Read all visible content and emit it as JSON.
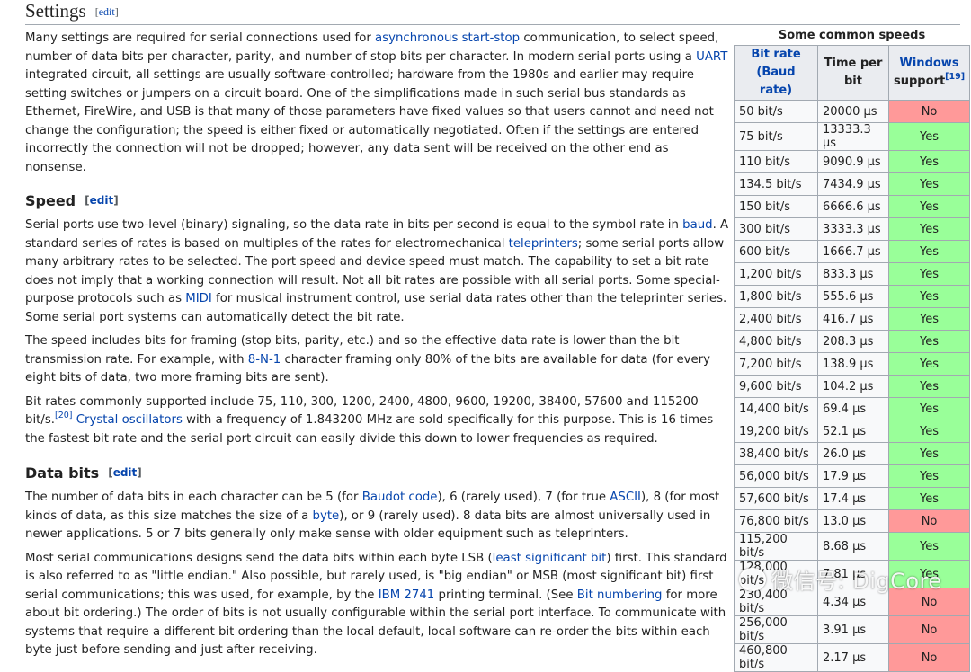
{
  "settings": {
    "heading": "Settings",
    "edit_label": "edit",
    "p1": {
      "t1": "Many settings are required for serial connections used for ",
      "l1": "asynchronous start-stop",
      "t2": " communication, to select speed, number of data bits per character, parity, and number of stop bits per character. In modern serial ports using a ",
      "l2": "UART",
      "t3": " integrated circuit, all settings are usually software-controlled; hardware from the 1980s and earlier may require setting switches or jumpers on a circuit board. One of the simplifications made in such serial bus standards as Ethernet, FireWire, and USB is that many of those parameters have fixed values so that users cannot and need not change the configuration; the speed is either fixed or automatically negotiated. Often if the settings are entered incorrectly the connection will not be dropped; however, any data sent will be received on the other end as nonsense."
    }
  },
  "speed": {
    "heading": "Speed",
    "edit_label": "edit",
    "p1": {
      "t1": "Serial ports use two-level (binary) signaling, so the data rate in bits per second is equal to the symbol rate in ",
      "l1": "baud",
      "t2": ". A standard series of rates is based on multiples of the rates for electromechanical ",
      "l2": "teleprinters",
      "t3": "; some serial ports allow many arbitrary rates to be selected. The port speed and device speed must match. The capability to set a bit rate does not imply that a working connection will result. Not all bit rates are possible with all serial ports. Some special-purpose protocols such as ",
      "l3": "MIDI",
      "t4": " for musical instrument control, use serial data rates other than the teleprinter series. Some serial port systems can automatically detect the bit rate."
    },
    "p2": {
      "t1": "The speed includes bits for framing (stop bits, parity, etc.) and so the effective data rate is lower than the bit transmission rate. For example, with ",
      "l1": "8-N-1",
      "t2": " character framing only 80% of the bits are available for data (for every eight bits of data, two more framing bits are sent)."
    },
    "p3": {
      "t1": "Bit rates commonly supported include 75, 110, 300, 1200, 2400, 4800, 9600, 19200, 38400, 57600 and 115200 bit/s.",
      "ref": "[20]",
      "t2": " ",
      "l1": "Crystal oscillators",
      "t3": " with a frequency of 1.843200 MHz are sold specifically for this purpose. This is 16 times the fastest bit rate and the serial port circuit can easily divide this down to lower frequencies as required."
    }
  },
  "databits": {
    "heading": "Data bits",
    "edit_label": "edit",
    "p1": {
      "t1": "The number of data bits in each character can be 5 (for ",
      "l1": "Baudot code",
      "t2": "), 6 (rarely used), 7 (for true ",
      "l2": "ASCII",
      "t3": "), 8 (for most kinds of data, as this size matches the size of a ",
      "l3": "byte",
      "t4": "), or 9 (rarely used). 8 data bits are almost universally used in newer applications. 5 or 7 bits generally only make sense with older equipment such as teleprinters."
    },
    "p2": {
      "t1": "Most serial communications designs send the data bits within each byte LSB (",
      "l1": "least significant bit",
      "t2": ") first. This standard is also referred to as \"little endian.\" Also possible, but rarely used, is \"big endian\" or MSB (most significant bit) first serial communications; this was used, for example, by the ",
      "l2": "IBM 2741",
      "t3": " printing terminal. (See ",
      "l3": "Bit numbering",
      "t4": " for more about bit ordering.) The order of bits is not usually configurable within the serial port interface. To communicate with systems that require a different bit ordering than the local default, local software can re-order the bits within each byte just before sending and just after receiving."
    }
  },
  "speeds_table": {
    "caption": "Some common speeds",
    "col_rate_l1": "Bit rate",
    "col_rate_l2": "(Baud rate)",
    "col_time_l1": "Time per",
    "col_time_l2": "bit",
    "col_win_l1": "Windows",
    "col_win_l2": "support",
    "col_win_ref": "[19]",
    "rows": [
      {
        "rate": "50 bit/s",
        "time": "20000 µs",
        "support": "No"
      },
      {
        "rate": "75 bit/s",
        "time": "13333.3 µs",
        "support": "Yes"
      },
      {
        "rate": "110 bit/s",
        "time": "9090.9 µs",
        "support": "Yes"
      },
      {
        "rate": "134.5 bit/s",
        "time": "7434.9 µs",
        "support": "Yes"
      },
      {
        "rate": "150 bit/s",
        "time": "6666.6 µs",
        "support": "Yes"
      },
      {
        "rate": "300 bit/s",
        "time": "3333.3 µs",
        "support": "Yes"
      },
      {
        "rate": "600 bit/s",
        "time": "1666.7 µs",
        "support": "Yes"
      },
      {
        "rate": "1,200 bit/s",
        "time": "833.3 µs",
        "support": "Yes"
      },
      {
        "rate": "1,800 bit/s",
        "time": "555.6 µs",
        "support": "Yes"
      },
      {
        "rate": "2,400 bit/s",
        "time": "416.7 µs",
        "support": "Yes"
      },
      {
        "rate": "4,800 bit/s",
        "time": "208.3 µs",
        "support": "Yes"
      },
      {
        "rate": "7,200 bit/s",
        "time": "138.9 µs",
        "support": "Yes"
      },
      {
        "rate": "9,600 bit/s",
        "time": "104.2 µs",
        "support": "Yes"
      },
      {
        "rate": "14,400 bit/s",
        "time": "69.4 µs",
        "support": "Yes"
      },
      {
        "rate": "19,200 bit/s",
        "time": "52.1 µs",
        "support": "Yes"
      },
      {
        "rate": "38,400 bit/s",
        "time": "26.0 µs",
        "support": "Yes"
      },
      {
        "rate": "56,000 bit/s",
        "time": "17.9 µs",
        "support": "Yes"
      },
      {
        "rate": "57,600 bit/s",
        "time": "17.4 µs",
        "support": "Yes"
      },
      {
        "rate": "76,800 bit/s",
        "time": "13.0 µs",
        "support": "No"
      },
      {
        "rate": "115,200 bit/s",
        "time": "8.68 µs",
        "support": "Yes"
      },
      {
        "rate": "128,000 bit/s",
        "time": "7.81 µs",
        "support": "Yes"
      },
      {
        "rate": "230,400 bit/s",
        "time": "4.34 µs",
        "support": "No"
      },
      {
        "rate": "256,000 bit/s",
        "time": "3.91 µs",
        "support": "No"
      },
      {
        "rate": "460,800 bit/s",
        "time": "2.17 µs",
        "support": "No"
      }
    ]
  },
  "watermark": {
    "text": "微信号: DigCore"
  },
  "colors": {
    "yes": "#99ff99",
    "no": "#ff9999",
    "link": "#0645ad"
  }
}
